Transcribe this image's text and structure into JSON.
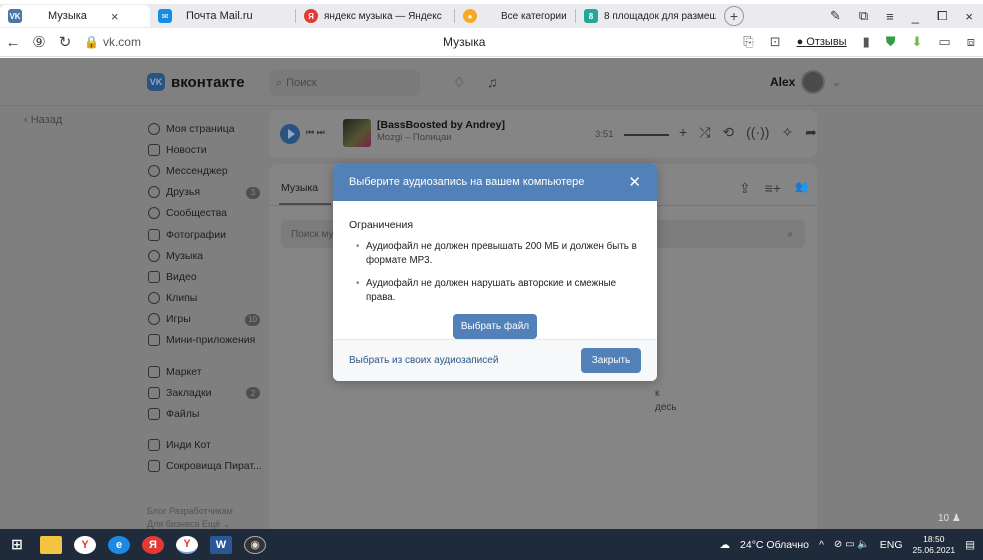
{
  "browser": {
    "tabs": [
      {
        "label": "Музыка",
        "favicon": "VK",
        "favicon_color": "#4a76a8",
        "active": true
      },
      {
        "label": "Почта Mail.ru",
        "favicon": "✉",
        "favicon_color": "#168de2",
        "active": false
      },
      {
        "label": "яндекс музыка — Яндекс",
        "favicon": "Я",
        "favicon_color": "#e53935",
        "active": false
      },
      {
        "label": "Все категории",
        "favicon": "●",
        "favicon_color": "#f9a825",
        "active": false
      },
      {
        "label": "8 площадок для размеще",
        "favicon": "8",
        "favicon_color": "#26a69a",
        "active": false
      }
    ],
    "url": "vk.com",
    "page_title": "Музыка",
    "otzyvy_label": "Отзывы"
  },
  "vk": {
    "logo_text": "вконтакте",
    "search_placeholder": "Поиск",
    "user_name": "Alex",
    "back_label": "Назад",
    "sidebar": [
      {
        "label": "Моя страница",
        "badge": ""
      },
      {
        "label": "Новости",
        "badge": ""
      },
      {
        "label": "Мессенджер",
        "badge": ""
      },
      {
        "label": "Друзья",
        "badge": "3"
      },
      {
        "label": "Сообщества",
        "badge": ""
      },
      {
        "label": "Фотографии",
        "badge": ""
      },
      {
        "label": "Музыка",
        "badge": ""
      },
      {
        "label": "Видео",
        "badge": ""
      },
      {
        "label": "Клипы",
        "badge": ""
      },
      {
        "label": "Игры",
        "badge": "10"
      },
      {
        "label": "Мини-приложения",
        "badge": ""
      }
    ],
    "sidebar2": [
      {
        "label": "Маркет",
        "badge": ""
      },
      {
        "label": "Закладки",
        "badge": "2"
      },
      {
        "label": "Файлы",
        "badge": ""
      }
    ],
    "sidebar3": [
      {
        "label": "Инди Кот",
        "badge": ""
      },
      {
        "label": "Сокровища Пират...",
        "badge": ""
      }
    ],
    "footer_line1": "Блог  Разработчикам",
    "footer_line2": "Для бизнеса  Ещё ⌄",
    "player": {
      "title": "[BassBoosted by Andrey]",
      "artist": "Mozgi – Полицаи",
      "time": "3:51"
    },
    "music": {
      "tab_label": "Музыка",
      "search_placeholder": "Поиск му",
      "fragment1": "к",
      "fragment2": "десь"
    },
    "counter": "10 ♟"
  },
  "modal": {
    "title": "Выберите аудиозапись на вашем компьютере",
    "limits_title": "Ограничения",
    "limits": [
      "Аудиофайл не должен превышать 200 МБ и должен быть в формате MP3.",
      "Аудиофайл не должен нарушать авторские и смежные права."
    ],
    "choose_button": "Выбрать файл",
    "footer_link": "Выбрать из своих аудиозаписей",
    "close_button": "Закрыть",
    "accent": "#5181b8"
  },
  "taskbar": {
    "weather": "24°C Облачно",
    "lang": "ENG",
    "time": "18:50",
    "date": "25.06.2021"
  }
}
